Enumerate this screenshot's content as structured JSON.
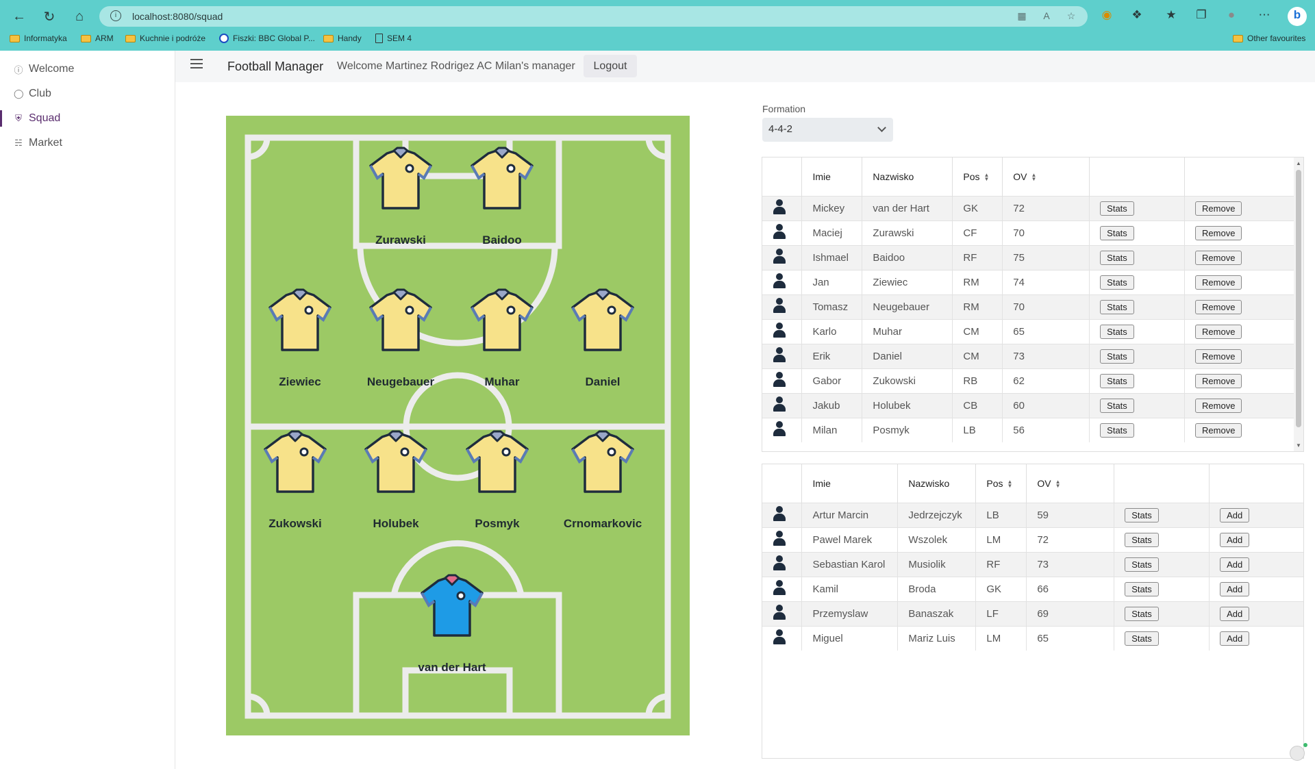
{
  "browser": {
    "url": "localhost:8080/squad",
    "bookmarks": [
      "Informatyka",
      "ARM",
      "Kuchnie i podróże",
      "Fiszki: BBC Global P...",
      "Handy",
      "SEM 4"
    ],
    "other_favourites": "Other favourites"
  },
  "sidebar": {
    "items": [
      {
        "label": "Welcome",
        "icon": "info-icon"
      },
      {
        "label": "Club",
        "icon": "bulb-icon"
      },
      {
        "label": "Squad",
        "icon": "shield-icon",
        "active": true
      },
      {
        "label": "Market",
        "icon": "cart-icon"
      }
    ]
  },
  "header": {
    "brand": "Football Manager",
    "welcome": "Welcome Martinez Rodrigez AC Milan's manager",
    "logout": "Logout"
  },
  "pitch": {
    "players": [
      {
        "name": "Zurawski",
        "kit": "outfield"
      },
      {
        "name": "Baidoo",
        "kit": "outfield"
      },
      {
        "name": "Ziewiec",
        "kit": "outfield"
      },
      {
        "name": "Neugebauer",
        "kit": "outfield"
      },
      {
        "name": "Muhar",
        "kit": "outfield"
      },
      {
        "name": "Daniel",
        "kit": "outfield"
      },
      {
        "name": "Zukowski",
        "kit": "outfield"
      },
      {
        "name": "Holubek",
        "kit": "outfield"
      },
      {
        "name": "Posmyk",
        "kit": "outfield"
      },
      {
        "name": "Crnomarkovic",
        "kit": "outfield"
      },
      {
        "name": "van der Hart",
        "kit": "goalkeeper"
      }
    ]
  },
  "formation": {
    "label": "Formation",
    "value": "4-4-2"
  },
  "squad_table": {
    "headers": [
      "",
      "Imie",
      "Nazwisko",
      "Pos",
      "OV",
      "",
      ""
    ],
    "rows": [
      {
        "first": "Mickey",
        "last": "van der Hart",
        "pos": "GK",
        "ov": "72"
      },
      {
        "first": "Maciej",
        "last": "Zurawski",
        "pos": "CF",
        "ov": "70"
      },
      {
        "first": "Ishmael",
        "last": "Baidoo",
        "pos": "RF",
        "ov": "75"
      },
      {
        "first": "Jan",
        "last": "Ziewiec",
        "pos": "RM",
        "ov": "74"
      },
      {
        "first": "Tomasz",
        "last": "Neugebauer",
        "pos": "RM",
        "ov": "70"
      },
      {
        "first": "Karlo",
        "last": "Muhar",
        "pos": "CM",
        "ov": "65"
      },
      {
        "first": "Erik",
        "last": "Daniel",
        "pos": "CM",
        "ov": "73"
      },
      {
        "first": "Gabor",
        "last": "Zukowski",
        "pos": "RB",
        "ov": "62"
      },
      {
        "first": "Jakub",
        "last": "Holubek",
        "pos": "CB",
        "ov": "60"
      },
      {
        "first": "Milan",
        "last": "Posmyk",
        "pos": "LB",
        "ov": "56"
      }
    ],
    "stats_label": "Stats",
    "remove_label": "Remove"
  },
  "market_table": {
    "headers": [
      "",
      "Imie",
      "Nazwisko",
      "Pos",
      "OV",
      "",
      ""
    ],
    "rows": [
      {
        "first": "Artur Marcin",
        "last": "Jedrzejczyk",
        "pos": "LB",
        "ov": "59"
      },
      {
        "first": "Pawel Marek",
        "last": "Wszolek",
        "pos": "LM",
        "ov": "72"
      },
      {
        "first": "Sebastian Karol",
        "last": "Musiolik",
        "pos": "RF",
        "ov": "73"
      },
      {
        "first": "Kamil",
        "last": "Broda",
        "pos": "GK",
        "ov": "66"
      },
      {
        "first": "Przemyslaw",
        "last": "Banaszak",
        "pos": "LF",
        "ov": "69"
      },
      {
        "first": "Miguel",
        "last": "Mariz Luis",
        "pos": "LM",
        "ov": "65"
      }
    ],
    "stats_label": "Stats",
    "add_label": "Add"
  },
  "colors": {
    "browser_bar": "#5ecfcc",
    "pitch_green": "#9cc965",
    "outfield_shirt": "#f7e28a",
    "goalkeeper_shirt": "#1e9be6",
    "accent": "#5a2d6e"
  }
}
